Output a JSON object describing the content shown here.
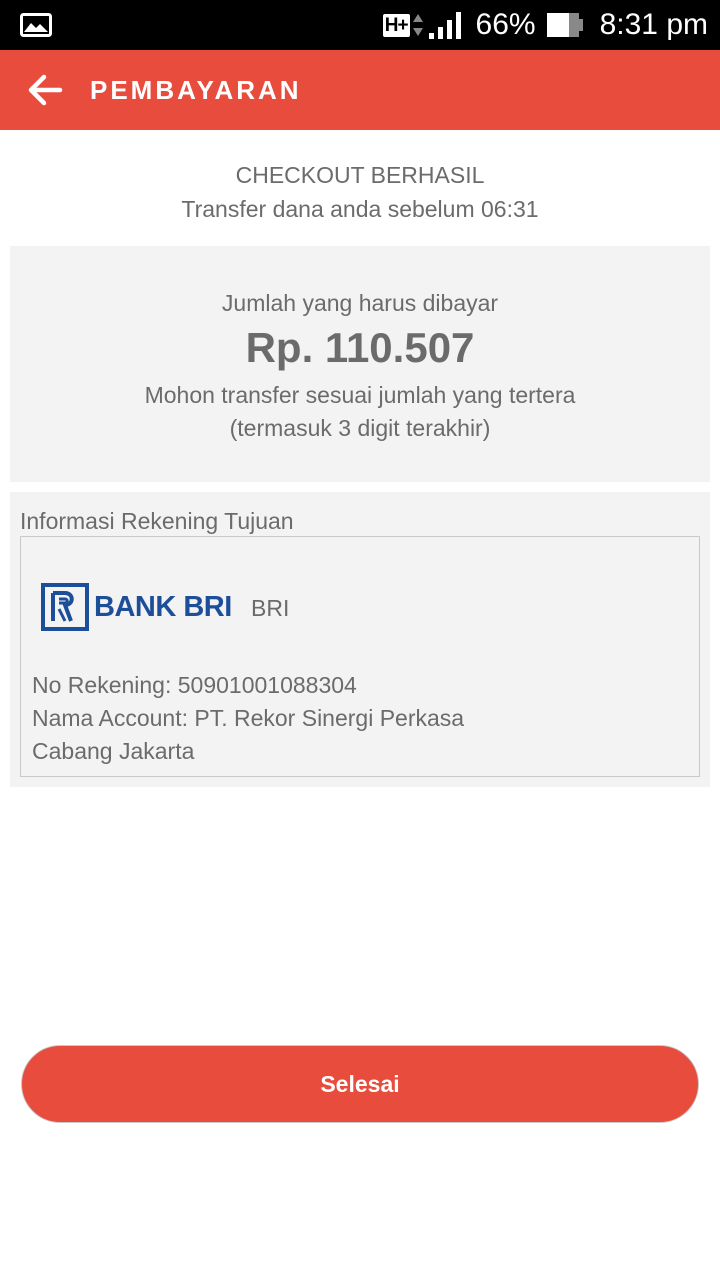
{
  "status_bar": {
    "network": "H+",
    "battery_percent": "66%",
    "time": "8:31 pm"
  },
  "app_bar": {
    "title": "PEMBAYARAN",
    "back_icon": "arrow-left-icon"
  },
  "checkout": {
    "title": "CHECKOUT BERHASIL",
    "subtitle": "Transfer dana anda sebelum 06:31"
  },
  "amount": {
    "label": "Jumlah yang harus dibayar",
    "value": "Rp. 110.507",
    "note_line1": "Mohon transfer sesuai jumlah yang tertera",
    "note_line2": "(termasuk 3 digit terakhir)"
  },
  "account": {
    "heading": "Informasi Rekening Tujuan",
    "bank_logo_text": "BANK BRI",
    "bank_code": "BRI",
    "account_number": "No Rekening: 50901001088304",
    "account_name": "Nama Account: PT. Rekor Sinergi Perkasa",
    "branch": "Cabang Jakarta"
  },
  "actions": {
    "done_label": "Selesai"
  },
  "colors": {
    "primary": "#e84c3d",
    "text": "#6b6b6b",
    "card_bg": "#f3f3f3",
    "bank_blue": "#1d4e9a"
  }
}
